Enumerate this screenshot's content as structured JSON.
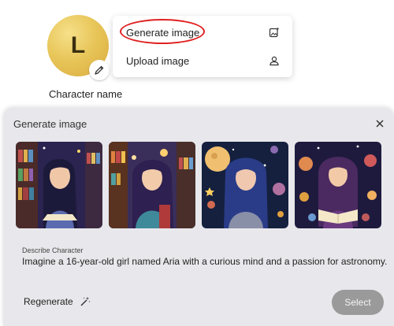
{
  "profile": {
    "initial": "L",
    "character_name_label": "Character name"
  },
  "menu": {
    "generate_label": "Generate image",
    "upload_label": "Upload image"
  },
  "dialog": {
    "title": "Generate image",
    "describe_label": "Describe Character",
    "describe_text": "Imagine a 16-year-old girl named Aria with a curious mind and a passion for astronomy.",
    "regenerate_label": "Regenerate",
    "select_label": "Select"
  },
  "colors": {
    "highlight_ring": "#e02020",
    "dialog_bg": "#e8e8ec",
    "select_button": "#9a9a9a"
  }
}
